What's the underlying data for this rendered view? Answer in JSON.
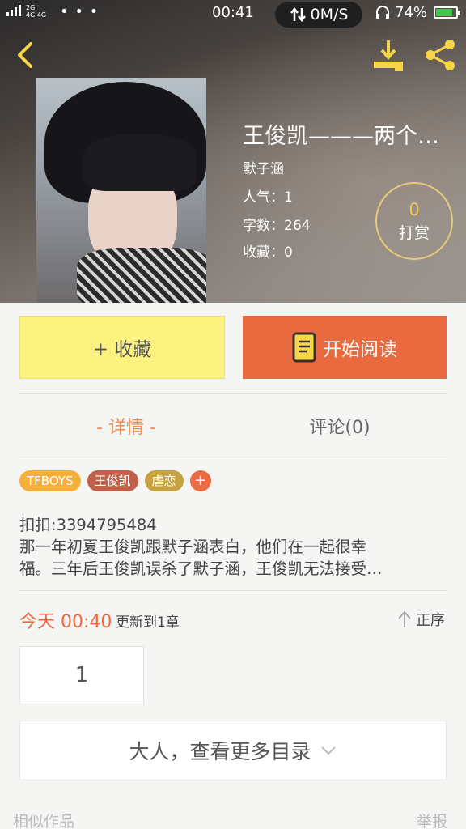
{
  "status_bar": {
    "network": "2G",
    "network2": "4G 4G",
    "dots": "• • •",
    "time": "00:41",
    "speed": "0M/S",
    "battery": "74%"
  },
  "book": {
    "title": "王俊凯———两个世…",
    "author": "默子涵",
    "popularity": "人气：1",
    "word_count": "字数：264",
    "favorites": "收藏：0"
  },
  "reward": {
    "count": "0",
    "label": "打赏"
  },
  "actions": {
    "favorite_label": "+ 收藏",
    "read_label": "开始阅读"
  },
  "tabs": {
    "detail": "- 详情 -",
    "comments": "评论(0)"
  },
  "tags": [
    "TFBOYS",
    "王俊凯",
    "虐恋"
  ],
  "tag_add": "+",
  "description": {
    "line1": "扣扣:3394795484",
    "line2": "那一年初夏王俊凯跟默子涵表白，他们在一起很幸",
    "line3": "福。三年后王俊凯误杀了默子涵，王俊凯无法接受…"
  },
  "update": {
    "time": "今天 00:40",
    "text": "更新到1章",
    "order": "正序"
  },
  "chapters": [
    "1"
  ],
  "more_toc": "大人，查看更多目录",
  "footer": {
    "similar": "相似作品",
    "report": "举报"
  },
  "colors": {
    "accent": "#ec6a43",
    "favorite_bg": "#fbf17f",
    "read_bg": "#e96a3e",
    "reward_gold": "#f3c75c",
    "icon_yellow": "#f7d548"
  }
}
